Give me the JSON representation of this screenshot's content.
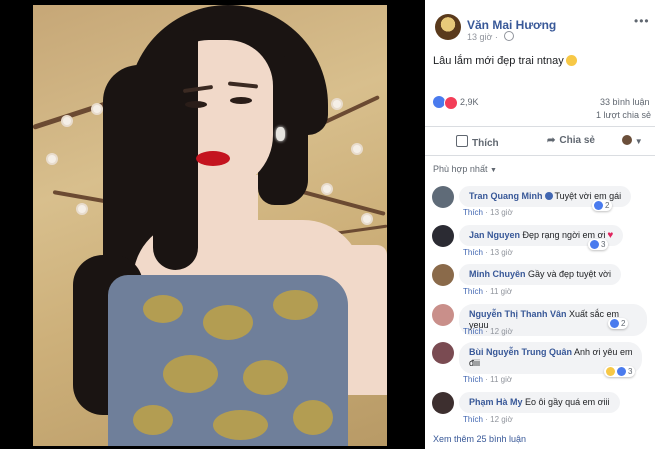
{
  "post": {
    "author": "Văn Mai Hương",
    "time": "13 giờ",
    "text": "Lâu lắm mới đẹp trai ntnay",
    "reaction_count": "2,9K",
    "comment_count": "33 bình luận",
    "share_count": "1 lượt chia sẻ"
  },
  "actions": {
    "like": "Thích",
    "share": "Chia sẻ"
  },
  "sort_label": "Phù hợp nhất",
  "comments": [
    {
      "name": "Tran Quang Minh",
      "text": "Tuyệt vời em gái",
      "like": "Thích",
      "time": "13 giờ",
      "reactions": "2",
      "verified": true
    },
    {
      "name": "Jan Nguyen",
      "text": "Đẹp rạng ngời em ơi",
      "like": "Thích",
      "time": "13 giờ",
      "reactions": "3"
    },
    {
      "name": "Minh Chuyên",
      "text": "Gầy và đẹp tuyệt vời",
      "like": "Thích",
      "time": "11 giờ"
    },
    {
      "name": "Nguyễn Thị Thanh Vân",
      "text": "Xuất sắc em yeuu",
      "like": "Thích",
      "time": "12 giờ",
      "reactions": "2"
    },
    {
      "name": "Bùi Nguyễn Trung Quân",
      "text": "Anh ơi yêu em",
      "text2": "điii",
      "like": "Thích",
      "time": "11 giờ",
      "reactions": "3"
    },
    {
      "name": "Phạm Hà My",
      "text": "Eo ôi gầy quá em ơiii",
      "like": "Thích",
      "time": "12 giờ"
    }
  ],
  "more_comments": "Xem thêm 25 bình luận",
  "colors": {
    "link": "#385898",
    "like_blue": "#4a7bee",
    "heart_red": "#f33e58",
    "lips": "#c4141f"
  }
}
